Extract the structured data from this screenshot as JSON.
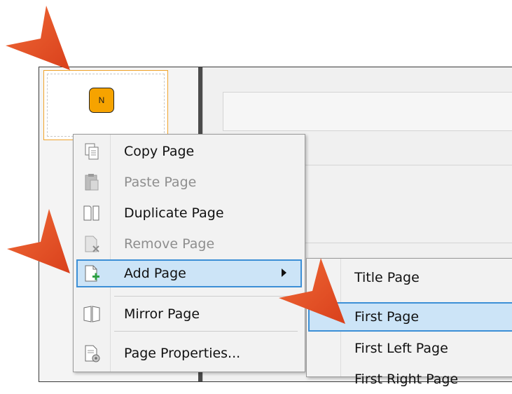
{
  "thumbnail": {
    "label": "N"
  },
  "context_menu": {
    "items": [
      {
        "label": "Copy Page",
        "icon": "copy-page-icon",
        "enabled": true
      },
      {
        "label": "Paste Page",
        "icon": "paste-page-icon",
        "enabled": false
      },
      {
        "label": "Duplicate Page",
        "icon": "duplicate-page-icon",
        "enabled": true
      },
      {
        "label": "Remove Page",
        "icon": "remove-page-icon",
        "enabled": false
      },
      {
        "label": "Add Page",
        "icon": "add-page-icon",
        "enabled": true,
        "highlighted": true,
        "has_submenu": true
      },
      {
        "label": "Mirror Page",
        "icon": "mirror-page-icon",
        "enabled": true
      },
      {
        "label": "Page Properties...",
        "icon": "page-properties-icon",
        "enabled": true
      }
    ]
  },
  "submenu": {
    "items": [
      {
        "label": "Title Page"
      },
      {
        "label": "First Page",
        "highlighted": true
      },
      {
        "label": "First Left Page"
      },
      {
        "label": "First Right Page"
      }
    ]
  },
  "colors": {
    "highlight_bg": "#cce4f7",
    "highlight_border": "#3c8fd6",
    "callout_arrow": "#e8522a",
    "thumbnail_icon": "#f6a300"
  }
}
